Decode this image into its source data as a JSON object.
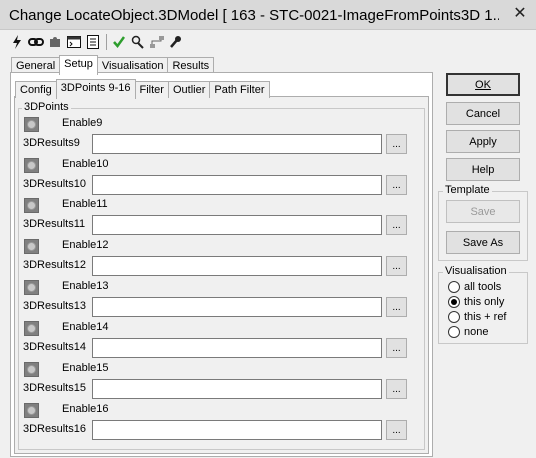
{
  "window": {
    "title": "Change LocateObject.3DModel [ 163 - STC-0021-ImageFromPoints3D 1..."
  },
  "toolbar": {
    "icons": [
      "lightning-icon",
      "link-icon",
      "puzzle-icon",
      "console-icon",
      "list-icon",
      "checkmark-icon",
      "run-icon",
      "network-icon",
      "wrench-icon"
    ]
  },
  "outer_tabs": [
    "General",
    "Setup",
    "Visualisation",
    "Results"
  ],
  "outer_active": "Setup",
  "inner_tabs": [
    "Config",
    "3DPoints 9-16",
    "Filter",
    "Outlier",
    "Path Filter"
  ],
  "inner_active": "3DPoints 9-16",
  "group": {
    "title": "3DPoints"
  },
  "rows": [
    {
      "enable": "Enable9",
      "result": "3DResults9",
      "value": ""
    },
    {
      "enable": "Enable10",
      "result": "3DResults10",
      "value": ""
    },
    {
      "enable": "Enable11",
      "result": "3DResults11",
      "value": ""
    },
    {
      "enable": "Enable12",
      "result": "3DResults12",
      "value": ""
    },
    {
      "enable": "Enable13",
      "result": "3DResults13",
      "value": ""
    },
    {
      "enable": "Enable14",
      "result": "3DResults14",
      "value": ""
    },
    {
      "enable": "Enable15",
      "result": "3DResults15",
      "value": ""
    },
    {
      "enable": "Enable16",
      "result": "3DResults16",
      "value": ""
    }
  ],
  "browse_label": "...",
  "buttons": {
    "ok": "OK",
    "cancel": "Cancel",
    "apply": "Apply",
    "help": "Help"
  },
  "template": {
    "title": "Template",
    "save": "Save",
    "save_as": "Save As"
  },
  "visualisation": {
    "title": "Visualisation",
    "options": [
      "all tools",
      "this only",
      "this + ref",
      "none"
    ],
    "selected": "this only"
  },
  "colors": {
    "window_bg": "#f0f0f0",
    "titlebar_bg": "#d9d9d9",
    "led": "#808080",
    "check_green": "#2e9e2e"
  }
}
